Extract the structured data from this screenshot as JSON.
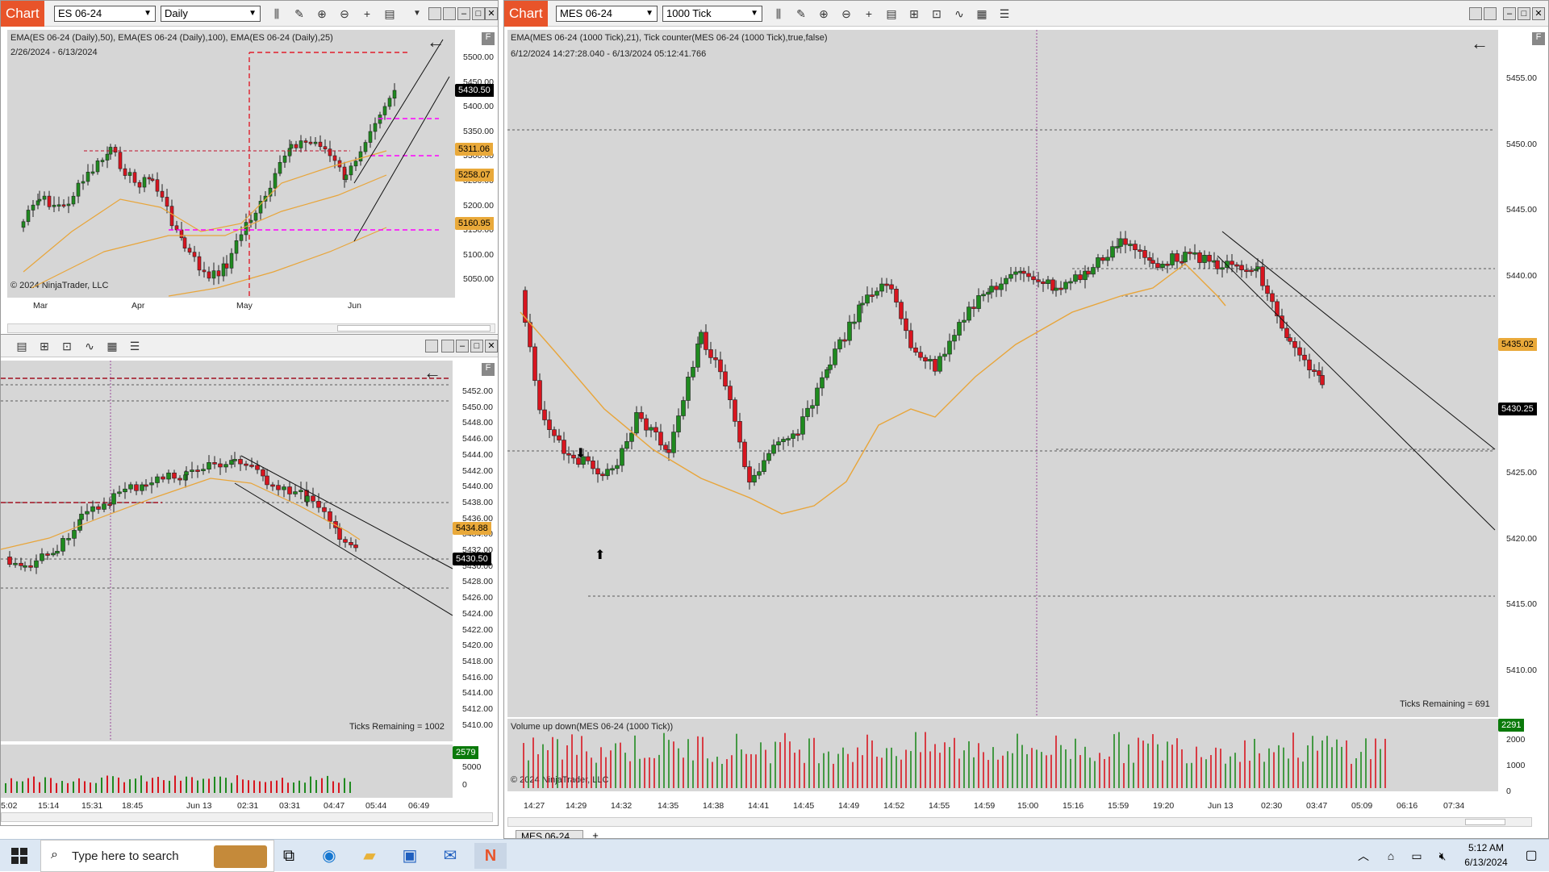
{
  "left_top": {
    "badge": "Chart",
    "instrument": "ES 06-24",
    "interval": "Daily",
    "indicators": "EMA(ES 06-24 (Daily),50), EMA(ES 06-24 (Daily),100), EMA(ES 06-24 (Daily),25)",
    "date_range": "2/26/2024 - 6/13/2024",
    "copyright": "© 2024 NinjaTrader, LLC",
    "price_labels": [
      "5500.00",
      "5450.00",
      "5400.00",
      "5350.00",
      "5300.00",
      "5250.00",
      "5200.00",
      "5150.00",
      "5100.00",
      "5050.00"
    ],
    "time_labels": [
      "Mar",
      "Apr",
      "May",
      "Jun"
    ],
    "tags": {
      "last": "5430.50",
      "t1": "5311.06",
      "t2": "5258.07",
      "t3": "5160.95"
    }
  },
  "left_bottom": {
    "price_labels": [
      "5452.00",
      "5450.00",
      "5448.00",
      "5446.00",
      "5444.00",
      "5442.00",
      "5440.00",
      "5438.00",
      "5436.00",
      "5434.00",
      "5432.00",
      "5430.00",
      "5428.00",
      "5426.00",
      "5424.00",
      "5422.00",
      "5420.00",
      "5418.00",
      "5416.00",
      "5414.00",
      "5412.00",
      "5410.00"
    ],
    "ticks_remaining": "Ticks Remaining = 1002",
    "tags": {
      "ema": "5434.88",
      "last": "5430.50",
      "volume": "2579"
    },
    "volume_labels": [
      "5000",
      "0"
    ],
    "time_labels": [
      "5:02",
      "15:14",
      "15:31",
      "18:45",
      "Jun 13",
      "02:31",
      "03:31",
      "04:47",
      "05:44",
      "06:49"
    ]
  },
  "right": {
    "badge": "Chart",
    "instrument": "MES 06-24",
    "interval": "1000 Tick",
    "indicators": "EMA(MES 06-24 (1000 Tick),21), Tick counter(MES 06-24 (1000 Tick),true,false)",
    "date_range": "6/12/2024 14:27:28.040 - 6/13/2024 05:12:41.766",
    "price_labels": [
      "5455.00",
      "5450.00",
      "5445.00",
      "5440.00",
      "5435.00",
      "5430.00",
      "5425.00",
      "5420.00",
      "5415.00",
      "5410.00"
    ],
    "ticks_remaining": "Ticks Remaining = 691",
    "volume_title": "Volume up down(MES 06-24 (1000 Tick))",
    "volume_labels": [
      "2000",
      "1000",
      "0"
    ],
    "copyright": "© 2024 NinjaTrader, LLC",
    "tags": {
      "ema": "5435.02",
      "last": "5430.25",
      "volume": "2291"
    },
    "time_labels": [
      "14:27",
      "14:29",
      "14:32",
      "14:35",
      "14:38",
      "14:41",
      "14:45",
      "14:49",
      "14:52",
      "14:55",
      "14:59",
      "15:00",
      "15:16",
      "15:59",
      "19:20",
      "Jun 13",
      "02:30",
      "03:47",
      "05:09",
      "06:16",
      "07:34"
    ],
    "tab": "MES 06-24",
    "tab_add": "+"
  },
  "taskbar": {
    "search_placeholder": "Type here to search",
    "time": "5:12 AM",
    "date": "6/13/2024"
  },
  "colors": {
    "up": "#1f8a1f",
    "down": "#d8151f",
    "ema": "#e8a53a",
    "plot_bg": "#d6d6d6",
    "magenta": "#ff00ff",
    "badge": "#e8542a"
  }
}
